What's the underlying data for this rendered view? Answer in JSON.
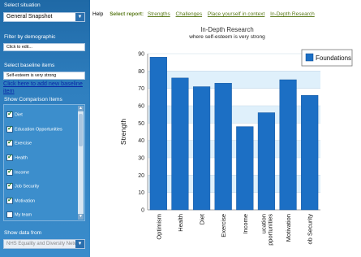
{
  "sidebar": {
    "situation_label": "Select situation",
    "situation_value": "General Snapshot",
    "demographic_label": "Filter by demographic",
    "demographic_placeholder": "Click to edit...",
    "baseline_label": "Select baseline items",
    "baseline_value": "Self-esteem is very strong",
    "baseline_link": "Click here to add new baseline item",
    "comparison_label": "Show Comparison Items",
    "comparison_items": [
      {
        "label": "Diet",
        "checked": true
      },
      {
        "label": "Education Opportunities",
        "checked": true
      },
      {
        "label": "Exercise",
        "checked": true
      },
      {
        "label": "Health",
        "checked": true
      },
      {
        "label": "Income",
        "checked": true
      },
      {
        "label": "Job Security",
        "checked": true
      },
      {
        "label": "Motivation",
        "checked": true
      },
      {
        "label": "My team",
        "checked": false
      }
    ],
    "data_from_label": "Show data from",
    "data_from_value": "NHS Equality and Diversity Netwo"
  },
  "topnav": {
    "help": "Help",
    "select_report": "Select report:",
    "links": [
      "Strengths",
      "Challenges",
      "Place yourself in context",
      "In-Depth Research"
    ]
  },
  "chart_data": {
    "type": "bar",
    "title": "In-Depth Research",
    "subtitle": "where self-esteem is very strong",
    "ylabel": "Strength",
    "xlabel": "",
    "ylim": [
      0,
      90
    ],
    "yticks": [
      0,
      10,
      20,
      30,
      40,
      50,
      60,
      70,
      80,
      90
    ],
    "categories": [
      "Optimism",
      "Health",
      "Diet",
      "Exercise",
      "Income",
      "Education Opportunities",
      "Motivation",
      "Job Security"
    ],
    "tick_labels": [
      "Optimism",
      "Health",
      "Diet",
      "Exercise",
      "Income",
      "ucation\npportunities",
      "Motivation",
      "ob Security"
    ],
    "series": [
      {
        "name": "Foundations",
        "values": [
          88,
          76,
          71,
          73,
          48,
          56,
          75,
          66
        ]
      }
    ],
    "legend_position": "top-right",
    "colors": {
      "bar": "#1c6fc4",
      "band_light": "#dff0fb",
      "band_white": "#ffffff"
    }
  }
}
